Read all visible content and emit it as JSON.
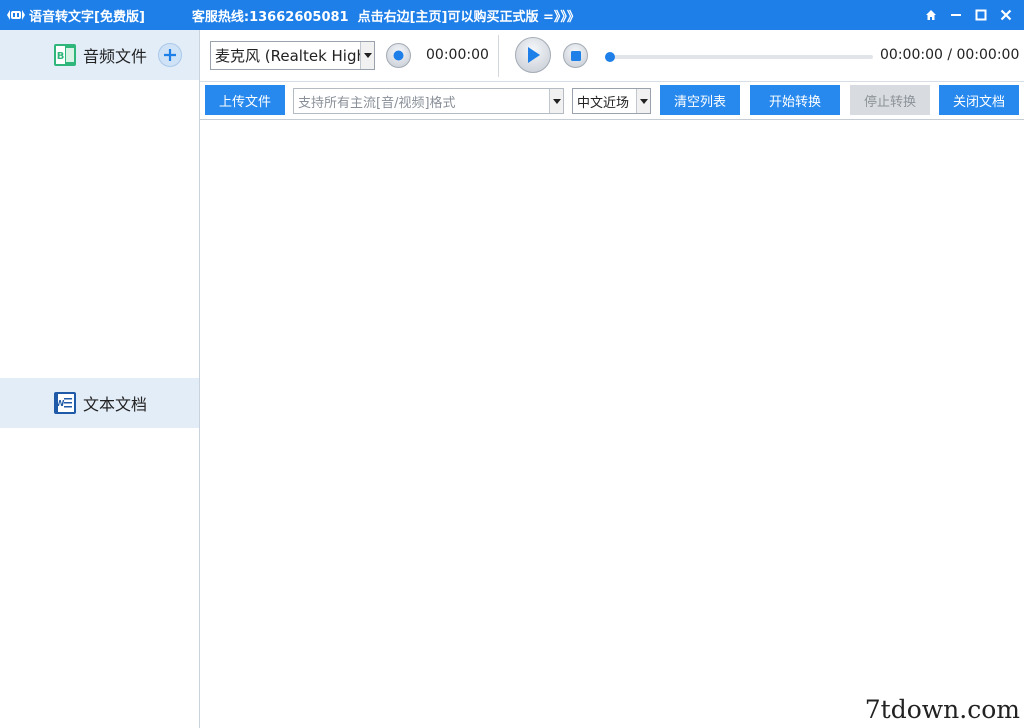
{
  "window": {
    "title": "语音转文字[免费版]",
    "hotline": "客服热线:13662605081",
    "notice": "点击右边[主页]可以购买正式版 =》》》",
    "controls": [
      "home-icon",
      "minimize-icon",
      "maximize-icon",
      "close-icon"
    ]
  },
  "sidebar": {
    "audio_label": "音频文件",
    "text_label": "文本文档"
  },
  "player": {
    "mic_device": "麦克风 (Realtek High",
    "record_time": "00:00:00",
    "playback_time": "00:00:00 / 00:00:00",
    "progress": 0
  },
  "toolbar": {
    "upload_label": "上传文件",
    "format_placeholder": "支持所有主流[音/视频]格式",
    "scene": "中文近场",
    "clear_label": "清空列表",
    "start_label": "开始转换",
    "stop_label": "停止转换",
    "close_label": "关闭文档"
  },
  "watermark": "7tdown.com",
  "colors": {
    "accent": "#1e7fe8",
    "button": "#2789ee",
    "sidebar_section": "#e3edf8",
    "disabled": "#d8dbdf"
  }
}
